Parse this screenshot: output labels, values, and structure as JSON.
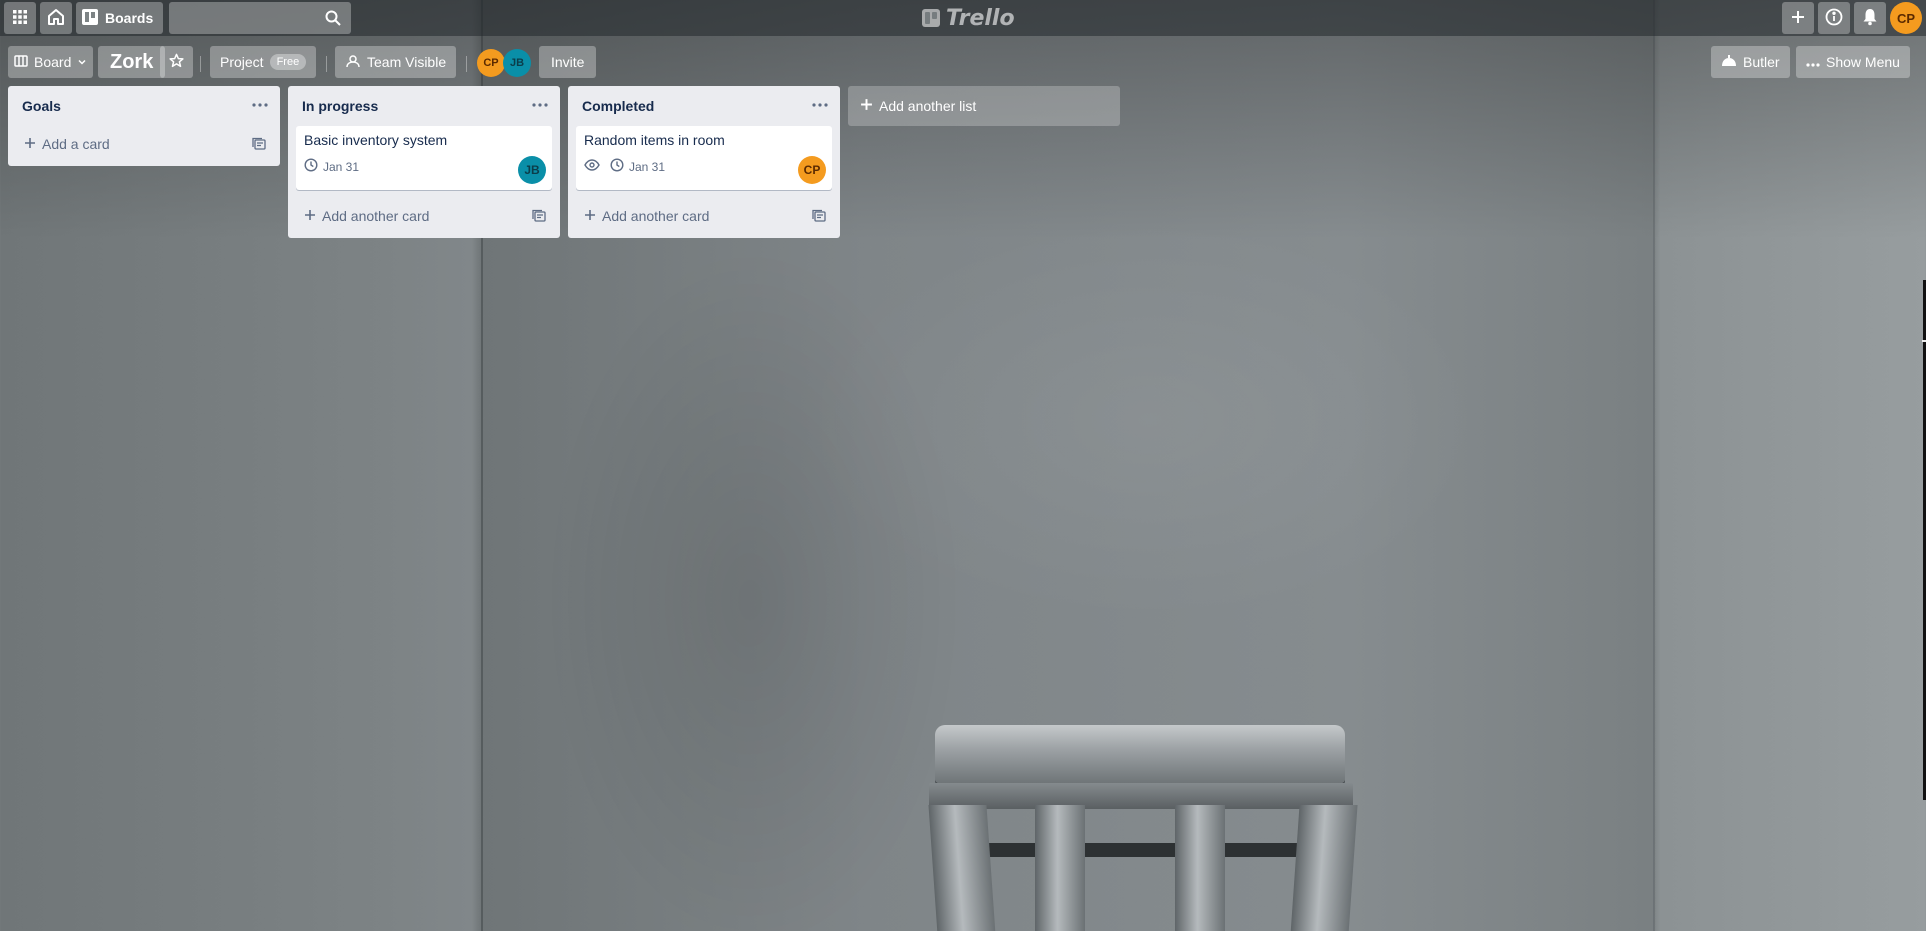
{
  "header": {
    "apps_icon": "grid-icon",
    "home_icon": "home-icon",
    "boards_label": "Boards",
    "search_placeholder": "",
    "logo_text": "Trello",
    "right": {
      "create_icon": "plus-icon",
      "info_icon": "info-icon",
      "notifications_icon": "bell-icon",
      "user_initials": "CP"
    }
  },
  "board_bar": {
    "board_switch_label": "Board",
    "board_title": "Zork",
    "star_icon": "star-icon",
    "team_label": "Project",
    "team_plan": "Free",
    "visibility_label": "Team Visible",
    "members": [
      "CP",
      "JB"
    ],
    "invite_label": "Invite",
    "butler_label": "Butler",
    "show_menu_label": "Show Menu"
  },
  "lists": [
    {
      "title": "Goals",
      "cards": [],
      "composer_label": "Add a card"
    },
    {
      "title": "In progress",
      "cards": [
        {
          "title": "Basic inventory system",
          "due": "Jan 31",
          "member": "JB",
          "watching": false
        }
      ],
      "composer_label": "Add another card"
    },
    {
      "title": "Completed",
      "cards": [
        {
          "title": "Random items in room",
          "due": "Jan 31",
          "member": "CP",
          "watching": true
        }
      ],
      "composer_label": "Add another card"
    }
  ],
  "add_list_label": "Add another list",
  "colors": {
    "accent_orange": "#f49b1f",
    "accent_teal": "#0a8fa8",
    "list_bg": "#ebecf0"
  }
}
